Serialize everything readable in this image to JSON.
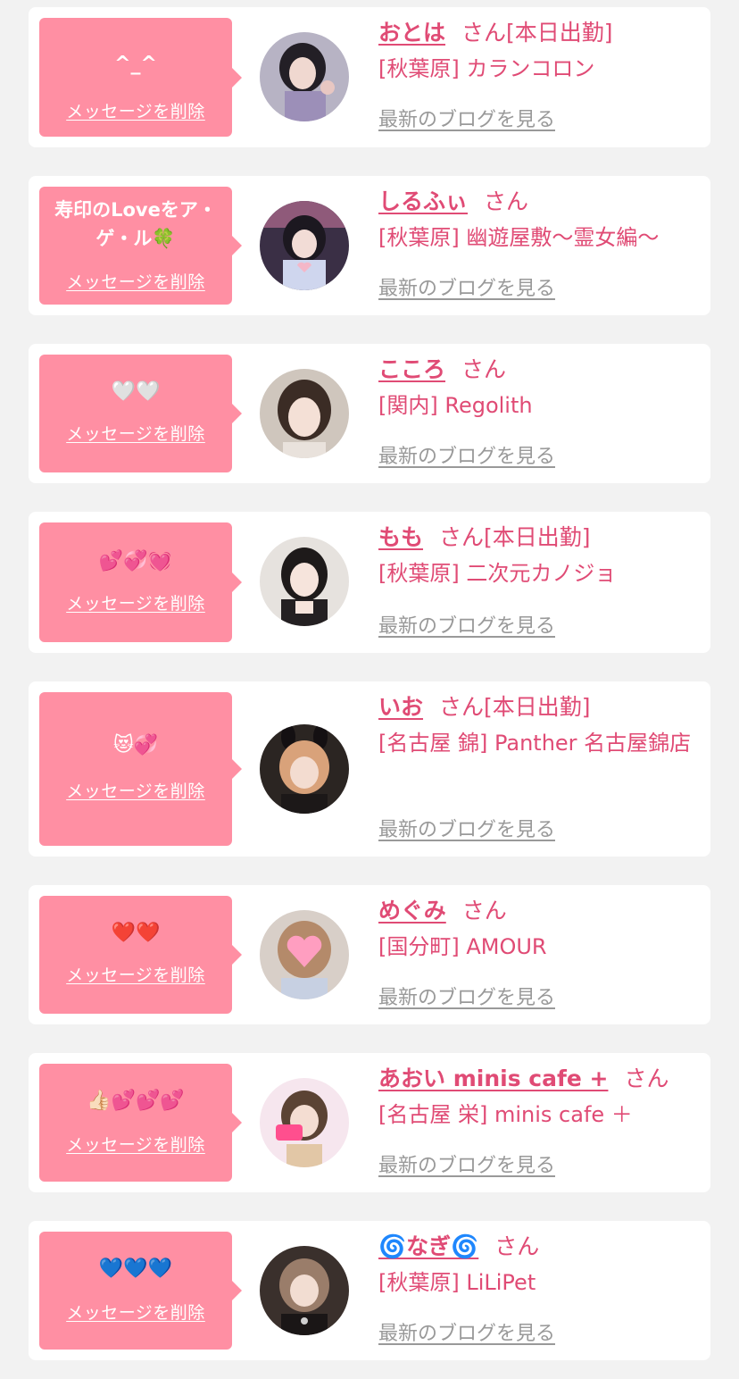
{
  "delete_label": "メッセージを削除",
  "blog_label": "最新のブログを見る",
  "honorific": "さん",
  "accent_color": "#e04b75",
  "bubble_color": "#ff8fa3",
  "messages": [
    {
      "message": "^_^",
      "name": "おとは",
      "attendance": "[本日出勤]",
      "shop": "[秋葉原] カランコロン"
    },
    {
      "message": "寿印のLoveをア・ゲ・ル🍀",
      "name": "しるふぃ",
      "attendance": "",
      "shop": "[秋葉原] 幽遊屋敷〜霊女編〜"
    },
    {
      "message": "🤍🤍",
      "name": "こころ",
      "attendance": "",
      "shop": "[関内] Regolith"
    },
    {
      "message": "💕💞💓",
      "name": "もも",
      "attendance": "[本日出勤]",
      "shop": "[秋葉原] 二次元カノジョ"
    },
    {
      "message": "😻💞",
      "name": "いお",
      "attendance": "[本日出勤]",
      "shop": "[名古屋 錦] Panther 名古屋錦店"
    },
    {
      "message": "❤️❤️",
      "name": "めぐみ",
      "attendance": "",
      "shop": "[国分町] AMOUR"
    },
    {
      "message": "👍🏻💕💕💕",
      "name": "あおい minis cafe +",
      "attendance": "",
      "shop": "[名古屋 栄] minis cafe ＋"
    },
    {
      "message": "💙💙💙",
      "name": "🌀なぎ🌀",
      "attendance": "",
      "shop": "[秋葉原] LiLiPet"
    }
  ]
}
